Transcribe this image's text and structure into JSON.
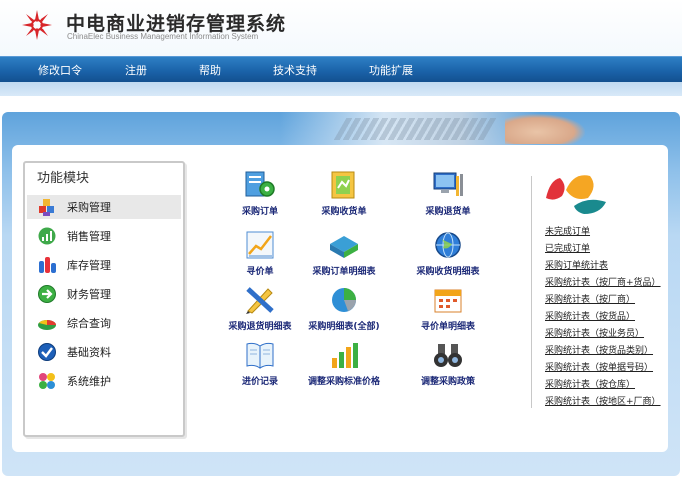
{
  "header": {
    "title": "中电商业进销存管理系统",
    "subtitle": "ChinaElec Business Management Information System"
  },
  "nav": {
    "items": [
      "修改口令",
      "注册",
      "帮助",
      "技术支持",
      "功能扩展"
    ]
  },
  "sidebar": {
    "title": "功能模块",
    "items": [
      {
        "label": "采购管理",
        "icon": "purchase-blocks-icon"
      },
      {
        "label": "销售管理",
        "icon": "sales-chart-icon"
      },
      {
        "label": "库存管理",
        "icon": "inventory-bars-icon"
      },
      {
        "label": "财务管理",
        "icon": "finance-arrow-icon"
      },
      {
        "label": "综合查询",
        "icon": "query-pie-icon"
      },
      {
        "label": "基础资料",
        "icon": "basic-data-check-icon"
      },
      {
        "label": "系统维护",
        "icon": "maintenance-puzzle-icon"
      }
    ]
  },
  "functions": [
    {
      "label": "采购订单",
      "icon": "gear-document-icon"
    },
    {
      "label": "采购收货单",
      "icon": "receipt-folder-icon"
    },
    {
      "label": "采购退货单",
      "icon": "monitor-tools-icon"
    },
    {
      "label": "寻价单",
      "icon": "line-chart-icon"
    },
    {
      "label": "采购订单明细表",
      "icon": "green-binder-icon"
    },
    {
      "label": "采购收货明细表",
      "icon": "globe-icon"
    },
    {
      "label": "采购退货明细表",
      "icon": "pencil-ruler-icon"
    },
    {
      "label": "采购明细表(全部)",
      "icon": "pie-chart-icon"
    },
    {
      "label": "寻价单明细表",
      "icon": "calendar-icon"
    },
    {
      "label": "进价记录",
      "icon": "book-icon"
    },
    {
      "label": "调整采购标准价格",
      "icon": "bar-chart-icon"
    },
    {
      "label": "调整采购政策",
      "icon": "binoculars-icon"
    }
  ],
  "reports": {
    "links": [
      "未完成订单",
      "已完成订单",
      "采购订单统计表",
      "采购统计表（按厂商+货品）",
      "采购统计表（按厂商）",
      "采购统计表（按货品）",
      "采购统计表（按业务员）",
      "采购统计表（按货品类别）",
      "采购统计表（按单据号码）",
      "采购统计表（按仓库）",
      "采购统计表（按地区+厂商）"
    ]
  },
  "colors": {
    "nav_bar": "#1b63aa",
    "function_label": "#1d2a78",
    "logo_red": "#d8262a",
    "brand_orange": "#f5a623",
    "brand_red": "#e2323a",
    "brand_teal": "#1a8a8e"
  }
}
